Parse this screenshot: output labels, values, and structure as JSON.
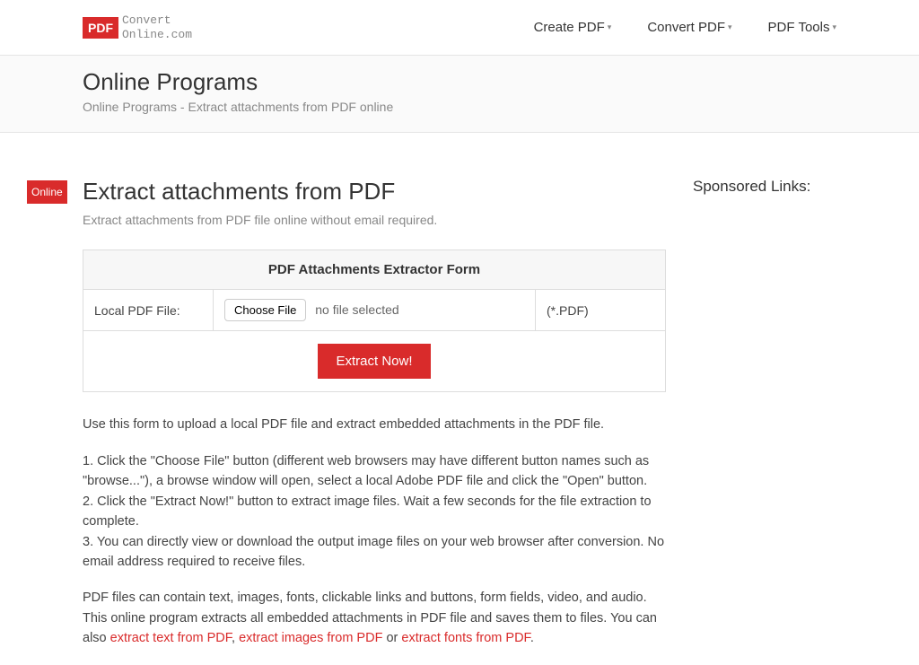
{
  "logo": {
    "badge": "PDF",
    "text_line1": "Convert",
    "text_line2": "Online.com"
  },
  "nav": {
    "items": [
      {
        "label": "Create PDF"
      },
      {
        "label": "Convert PDF"
      },
      {
        "label": "PDF Tools"
      }
    ]
  },
  "breadcrumb": {
    "title": "Online Programs",
    "subtitle": "Online Programs - Extract attachments from PDF online"
  },
  "online_badge": "Online",
  "page": {
    "title": "Extract attachments from PDF",
    "subtitle": "Extract attachments from PDF file online without email required."
  },
  "form": {
    "header": "PDF Attachments Extractor Form",
    "local_file_label": "Local PDF File:",
    "choose_file_btn": "Choose File",
    "no_file_text": "no file selected",
    "file_hint": "(*.PDF)",
    "extract_btn": "Extract Now!"
  },
  "content": {
    "intro": "Use this form to upload a local PDF file and extract embedded attachments in the PDF file.",
    "step1": "1. Click the \"Choose File\" button (different web browsers may have different button names such as \"browse...\"), a browse window will open, select a local Adobe PDF file and click the \"Open\" button.",
    "step2": "2. Click the \"Extract Now!\" button to extract image files. Wait a few seconds for the file extraction to complete.",
    "step3": "3. You can directly view or download the output image files on your web browser after conversion. No email address required to receive files.",
    "para2_part1": "PDF files can contain text, images, fonts, clickable links and buttons, form fields, video, and audio. This online program extracts all embedded attachments in PDF file and saves them to files. You can also ",
    "link1": "extract text from PDF",
    "para2_part2": ", ",
    "link2": "extract images from PDF",
    "para2_part3": " or ",
    "link3": "extract fonts from PDF",
    "para2_part4": "."
  },
  "sidebar": {
    "title": "Sponsored Links:"
  }
}
